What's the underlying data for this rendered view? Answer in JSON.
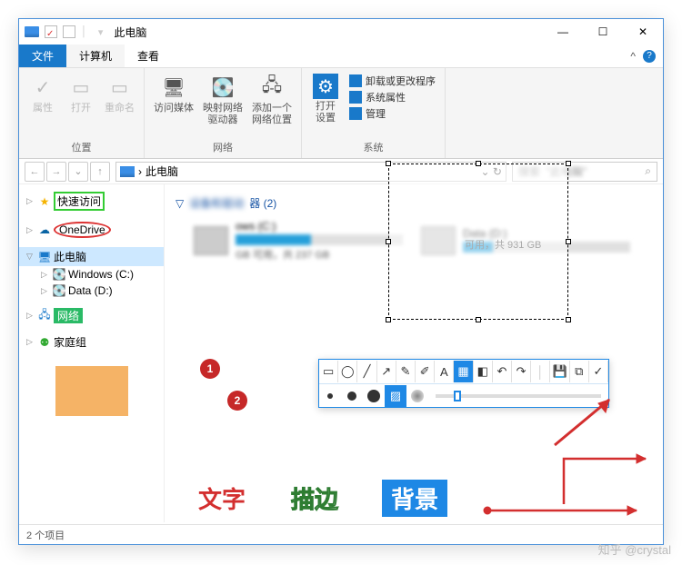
{
  "window": {
    "title": "此电脑"
  },
  "qat": {
    "save_icon": "save",
    "checkbox": true
  },
  "win_controls": {
    "min": "—",
    "max": "☐",
    "close": "✕"
  },
  "tabs": {
    "file": "文件",
    "computer": "计算机",
    "view": "查看",
    "caret": "^"
  },
  "ribbon": {
    "group_loc": "位置",
    "group_net": "网络",
    "group_sys": "系统",
    "props": "属性",
    "open": "打开",
    "rename": "重命名",
    "media": "访问媒体",
    "mapnet": "映射网络\n驱动器",
    "addnet": "添加一个\n网络位置",
    "settings": "打开\n设置",
    "sys1": "卸载或更改程序",
    "sys2": "系统属性",
    "sys3": "管理"
  },
  "addr": {
    "back": "←",
    "fwd": "→",
    "up": "↑",
    "path": "此电脑",
    "sep": "›",
    "refresh": "↻",
    "down": "⌄",
    "search_ph": "此电脑",
    "search_icon": "⌕"
  },
  "tree": {
    "quick": "快速访问",
    "onedrive": "OneDrive",
    "thispc": "此电脑",
    "winc": "Windows (C:)",
    "datad": "Data (D:)",
    "network": "网络",
    "homegroup": "家庭组"
  },
  "content": {
    "devices_hdr_suffix": "器 (2)",
    "drive1": {
      "name": "ows (C:)",
      "free": "GB 可用，共 237 GB",
      "fill_pct": 45
    },
    "drive2": {
      "free": "可用，共 931 GB",
      "fill_pct": 18
    }
  },
  "annot": {
    "circ1": "1",
    "circ2": "2",
    "text1": "文字",
    "text2": "描边",
    "text3": "背景"
  },
  "toolbar": {
    "icons": [
      "rect",
      "ellipse",
      "line",
      "arrow",
      "pen",
      "marker",
      "text",
      "blur",
      "eraser",
      "undo",
      "redo",
      "sep",
      "save",
      "copy",
      "ok"
    ]
  },
  "status": {
    "items": "2 个项目"
  },
  "watermark": "知乎 @crystal"
}
